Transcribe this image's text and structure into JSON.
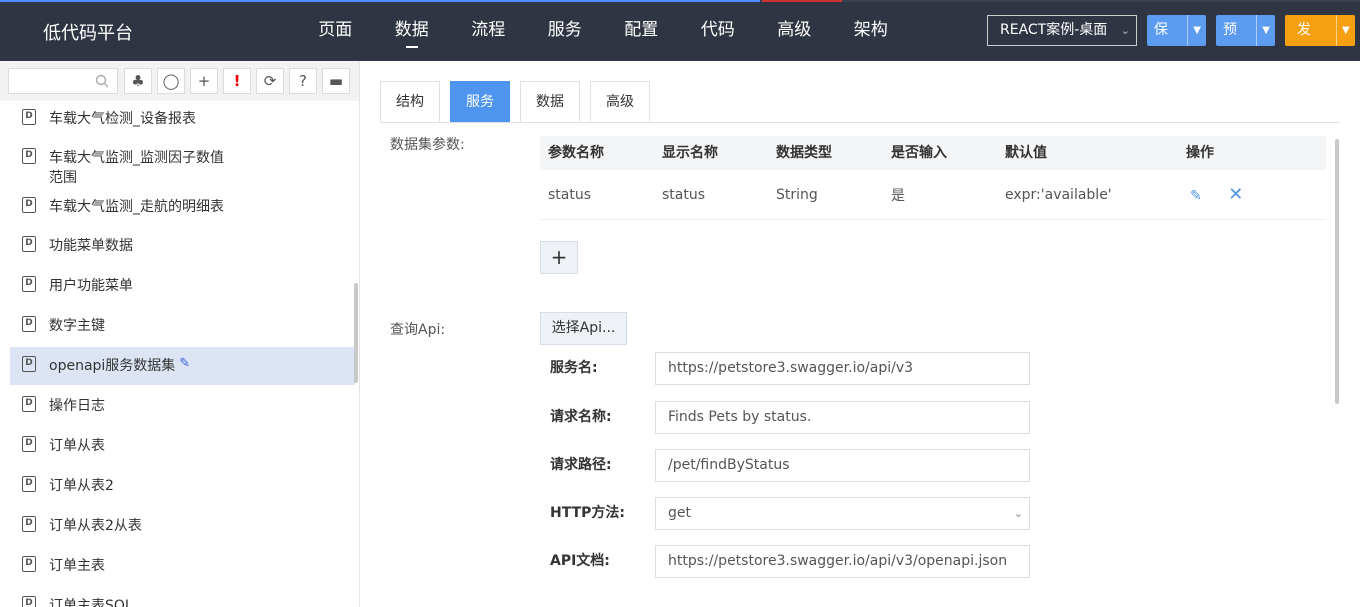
{
  "app": {
    "title": "低代码平台",
    "nav": [
      "页面",
      "数据",
      "流程",
      "服务",
      "配置",
      "代码",
      "高级",
      "架构"
    ],
    "active_nav": "数据",
    "app_select_value": "REACT案例-桌面",
    "save_label": "保存",
    "preview_label": "预览",
    "publish_label": "发布"
  },
  "sidebar": {
    "search_placeholder": "",
    "tools": [
      {
        "icon": "tree-icon",
        "glyph": "♣"
      },
      {
        "icon": "tag-icon",
        "glyph": "⌑"
      },
      {
        "icon": "plus-icon",
        "glyph": "+"
      },
      {
        "icon": "exclamation-icon",
        "glyph": "!"
      },
      {
        "icon": "refresh-icon",
        "glyph": "⟳"
      },
      {
        "icon": "help-icon",
        "glyph": "?"
      },
      {
        "icon": "window-icon",
        "glyph": "▬"
      }
    ],
    "items": [
      {
        "label": "车载大气检测_设备报表"
      },
      {
        "label": "车载大气监测_监测因子数值\n范围"
      },
      {
        "label": "车载大气监测_走航的明细表"
      },
      {
        "label": "功能菜单数据"
      },
      {
        "label": "用户功能菜单"
      },
      {
        "label": "数字主键"
      },
      {
        "label": "openapi服务数据集",
        "selected": true
      },
      {
        "label": "操作日志"
      },
      {
        "label": "订单从表"
      },
      {
        "label": "订单从表2"
      },
      {
        "label": "订单从表2从表"
      },
      {
        "label": "订单主表"
      },
      {
        "label": "订单主表SQL"
      }
    ]
  },
  "main": {
    "tabs": [
      "结构",
      "服务",
      "数据",
      "高级"
    ],
    "active_tab": "服务",
    "params_label": "数据集参数:",
    "params_headers": [
      "参数名称",
      "显示名称",
      "数据类型",
      "是否输入",
      "默认值",
      "操作"
    ],
    "params_rows": [
      {
        "name": "status",
        "display": "status",
        "type": "String",
        "input": "是",
        "default": "expr:'available'"
      }
    ],
    "query_api_label": "查询Api:",
    "select_api_button": "选择Api...",
    "service_name_label": "服务名:",
    "service_name_value": "https://petstore3.swagger.io/api/v3",
    "request_name_label": "请求名称:",
    "request_name_value": "Finds Pets by status.",
    "request_path_label": "请求路径:",
    "request_path_value": "/pet/findByStatus",
    "http_method_label": "HTTP方法:",
    "http_method_value": "get",
    "api_doc_label": "API文档:",
    "api_doc_value": "https://petstore3.swagger.io/api/v3/openapi.json"
  },
  "colors": {
    "topbar": "#2f3542",
    "primary": "#4e95ef",
    "publish": "#f7a012",
    "selected_row": "#dde5f5"
  }
}
